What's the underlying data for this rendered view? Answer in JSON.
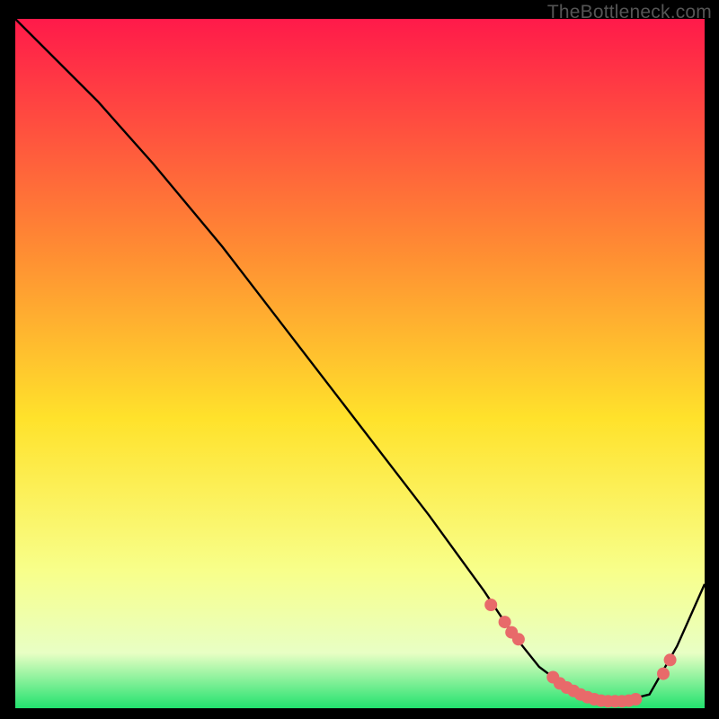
{
  "watermark": "TheBottleneck.com",
  "colors": {
    "grad_top": "#ff1a4a",
    "grad_mid_upper": "#ff8a33",
    "grad_mid": "#ffe22b",
    "grad_lower": "#f8ff8a",
    "grad_lower2": "#e8ffc4",
    "grad_bottom": "#22e26e",
    "curve": "#000000",
    "dot_fill": "#e86a6a",
    "dot_stroke": "#b24a4a"
  },
  "chart_data": {
    "type": "line",
    "title": "",
    "xlabel": "",
    "ylabel": "",
    "xlim": [
      0,
      100
    ],
    "ylim": [
      0,
      100
    ],
    "series": [
      {
        "name": "bottleneck-curve",
        "x": [
          0,
          6,
          12,
          20,
          30,
          40,
          50,
          60,
          68,
          72,
          76,
          80,
          84,
          88,
          92,
          96,
          100
        ],
        "y": [
          100,
          94,
          88,
          79,
          67,
          54,
          41,
          28,
          17,
          11,
          6,
          3,
          1.2,
          1,
          2,
          9,
          18
        ]
      }
    ],
    "optimal_points": {
      "name": "optimal-range-dots",
      "x": [
        69,
        71,
        72,
        73,
        78,
        79,
        80,
        81,
        82,
        83,
        84,
        85,
        86,
        87,
        88,
        89,
        90,
        94,
        95
      ],
      "y": [
        15,
        12.5,
        11,
        10,
        4.5,
        3.6,
        3,
        2.5,
        2,
        1.6,
        1.3,
        1.1,
        1,
        1,
        1,
        1.1,
        1.3,
        5,
        7
      ]
    }
  }
}
